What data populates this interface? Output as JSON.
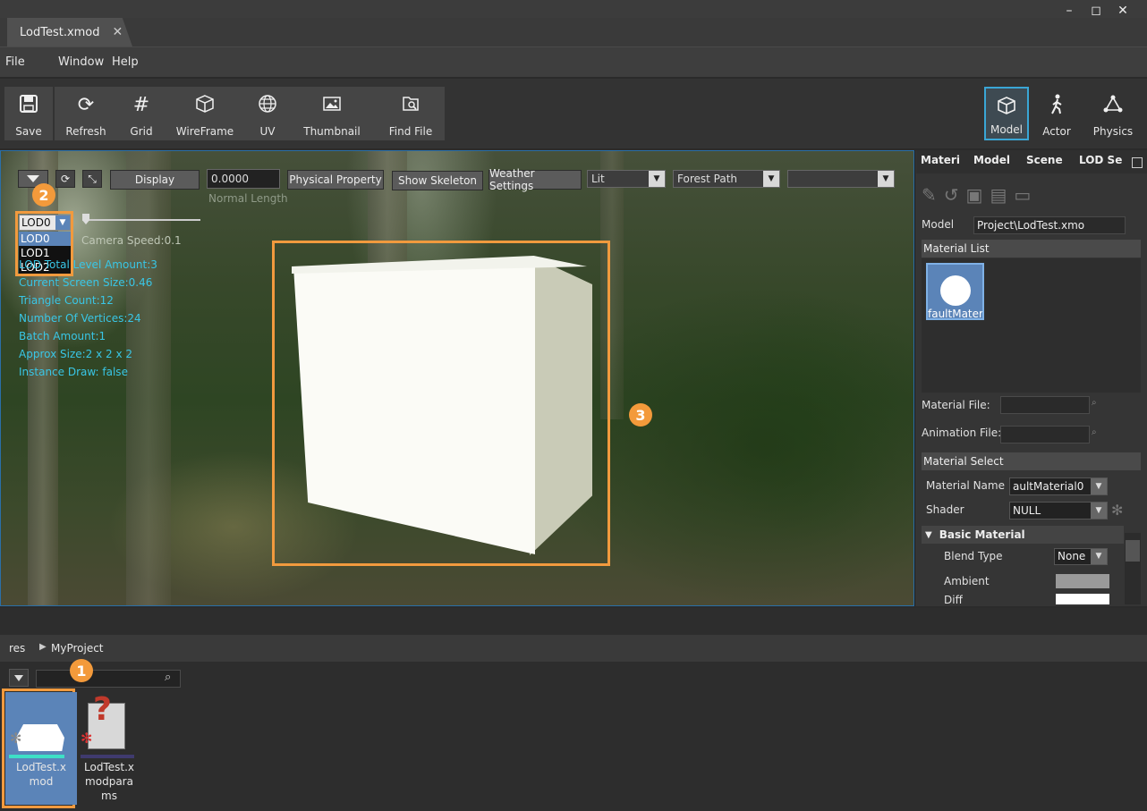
{
  "window": {
    "doc_tab": "LodTest.xmod",
    "min": "–",
    "max": "◻",
    "close": "✕",
    "tab_close": "✕"
  },
  "menu": [
    "File",
    "Window",
    "Help"
  ],
  "toolbar": {
    "save": "Save",
    "refresh": "Refresh",
    "grid": "Grid",
    "wireframe": "WireFrame",
    "uv": "UV",
    "thumbnail": "Thumbnail",
    "find_file": "Find File",
    "model": "Model",
    "actor": "Actor",
    "physics": "Physics"
  },
  "viewport": {
    "display_btn": "Display",
    "normal_value": "0.0000",
    "normal_label": "Normal Length",
    "physical_property": "Physical Property",
    "show_skeleton": "Show Skeleton",
    "weather_settings": "Weather Settings",
    "lighting": "Lit",
    "scene": "Forest Path",
    "extra": "",
    "lod_selected": "LOD0",
    "lod_options": [
      "LOD0",
      "LOD1",
      "LOD2"
    ],
    "camera_speed": "Camera Speed:0.1",
    "stats": [
      "LOD Total Level Amount:3",
      "Current Screen Size:0.46",
      "Triangle Count:12",
      "Number Of Vertices:24",
      "Batch Amount:1",
      "Approx Size:2 x 2 x 2",
      "Instance Draw: false"
    ]
  },
  "badges": {
    "one": "1",
    "two": "2",
    "three": "3"
  },
  "right_panel": {
    "tabs": [
      "Materi",
      "Model",
      "Scene",
      "LOD Se"
    ],
    "model_label": "Model",
    "model_value": "Project\\LodTest.xmo",
    "material_list": "Material List",
    "material_item": "faultMateri",
    "material_file": "Material File:",
    "animation_file": "Animation File:",
    "material_select": "Material Select",
    "material_name_label": "Material Name",
    "material_name_value": "aultMaterial0",
    "shader_label": "Shader",
    "shader_value": "NULL",
    "basic_material": "Basic Material",
    "blend_type_label": "Blend Type",
    "blend_type_value": "None",
    "ambient_label": "Ambient",
    "diffuse_label": "Diff"
  },
  "browser": {
    "crumb_root": "res",
    "crumb_child": "MyProject",
    "files": [
      {
        "line1": "LodTest.x",
        "line2": "mod",
        "line3": ""
      },
      {
        "line1": "LodTest.x",
        "line2": "modpara",
        "line3": "ms"
      }
    ]
  },
  "colors": {
    "accent": "#f19a3e",
    "select": "#5b84b8",
    "stat_text": "#39c6e6"
  }
}
